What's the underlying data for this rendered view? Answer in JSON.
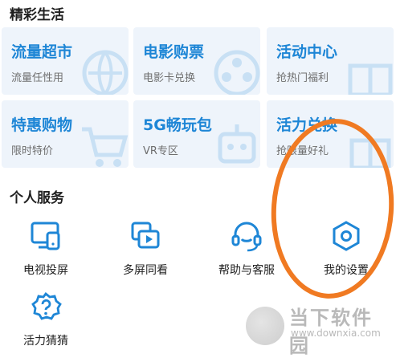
{
  "section1": {
    "title": "精彩生活"
  },
  "cards": [
    {
      "title": "流量超市",
      "subtitle": "流量任性用",
      "icon": "globe-icon"
    },
    {
      "title": "电影购票",
      "subtitle": "电影卡兑换",
      "icon": "film-reel-icon"
    },
    {
      "title": "活动中心",
      "subtitle": "抢热门福利",
      "icon": "gift-icon"
    },
    {
      "title": "特惠购物",
      "subtitle": "限时特价",
      "icon": "cart-icon"
    },
    {
      "title": "5G畅玩包",
      "subtitle": "VR专区",
      "icon": "robot-icon"
    },
    {
      "title": "活力兑换",
      "subtitle": "抢限量好礼",
      "icon": "gift-box-icon"
    }
  ],
  "section2": {
    "title": "个人服务"
  },
  "services": [
    {
      "label": "电视投屏",
      "icon": "tv-cast-icon"
    },
    {
      "label": "多屏同看",
      "icon": "multi-screen-icon"
    },
    {
      "label": "帮助与客服",
      "icon": "headset-icon"
    },
    {
      "label": "我的设置",
      "icon": "settings-hexagon-icon"
    },
    {
      "label": "活力猜猜",
      "icon": "question-badge-icon"
    }
  ],
  "watermark": {
    "name": "当下软件园",
    "url": "www.downxia.com"
  },
  "colors": {
    "accent": "#1e86d6",
    "highlight_ring": "#f07a22",
    "card_bg": "#eef4fb"
  }
}
